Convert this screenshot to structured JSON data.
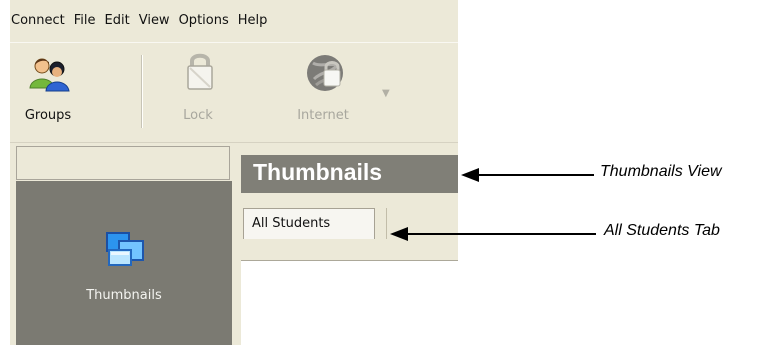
{
  "menu": {
    "items": [
      "Connect",
      "File",
      "Edit",
      "View",
      "Options",
      "Help"
    ]
  },
  "toolbar": {
    "groups_label": "Groups",
    "lock_label": "Lock",
    "internet_label": "Internet"
  },
  "sidebar": {
    "thumbnails_label": "Thumbnails"
  },
  "main": {
    "view_title": "Thumbnails",
    "tabs": [
      {
        "label": "All Students"
      }
    ]
  },
  "annotations": {
    "thumbnails_view": "Thumbnails View",
    "all_students_tab": "All Students Tab"
  }
}
